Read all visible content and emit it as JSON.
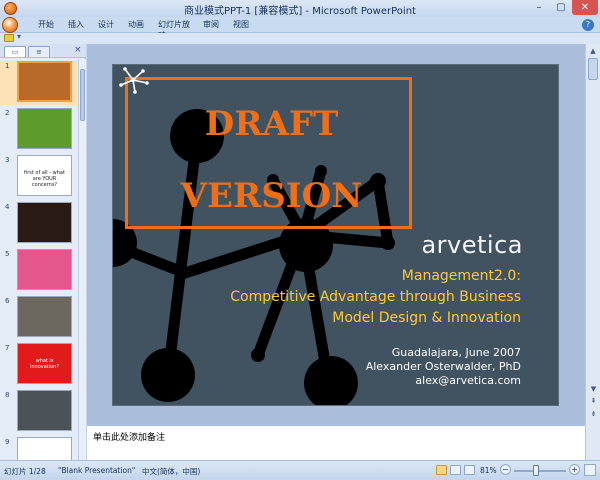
{
  "window": {
    "title": "商业模式PPT-1 [兼容模式] - Microsoft PowerPoint",
    "minimize_glyph": "–",
    "maximize_glyph": "▢",
    "close_glyph": "✕"
  },
  "ribbon": {
    "tabs": [
      "开始",
      "插入",
      "设计",
      "动画",
      "幻灯片放映",
      "审阅",
      "视图"
    ],
    "help_glyph": "?"
  },
  "qat": {
    "dropdown_glyph": "▾"
  },
  "panel": {
    "tab_slides_glyph": "▭",
    "tab_outline_glyph": "≡",
    "close_glyph": "×",
    "thumbnails": [
      {
        "number": "1",
        "bg": "#b86a2a",
        "text": "",
        "selected": true
      },
      {
        "number": "2",
        "bg": "#5d9b2a",
        "text": ""
      },
      {
        "number": "3",
        "bg": "#ffffff",
        "text": "first of all - what are YOUR concerns? ",
        "text_color": "#222222"
      },
      {
        "number": "4",
        "bg": "#2a1a14",
        "text": ""
      },
      {
        "number": "5",
        "bg": "#e4578c",
        "text": ""
      },
      {
        "number": "6",
        "bg": "#6c6860",
        "text": ""
      },
      {
        "number": "7",
        "bg": "#e31a1a",
        "text": "what is innovation?",
        "text_color": "#ffffff"
      },
      {
        "number": "8",
        "bg": "#4b5258",
        "text": ""
      },
      {
        "number": "9",
        "bg": "#ffffff",
        "text": "",
        "text_color": "#222222"
      }
    ]
  },
  "slide": {
    "draft_line1": "DRAFT",
    "draft_line2": "VERSION",
    "brand": "arvetica",
    "title_line1": "Management2.0:",
    "title_line2": "Competitive Advantage through Business",
    "title_line3": "Model Design & Innovation",
    "info_line1": "Guadalajara, June 2007",
    "info_line2": "Alexander Osterwalder, PhD",
    "info_line3": "alex@arvetica.com",
    "colors": {
      "background": "#415361",
      "draft": "#f06e17",
      "title": "#ffc936",
      "network": "#000000"
    }
  },
  "notes": {
    "placeholder": "单击此处添加备注"
  },
  "scroll": {
    "up_glyph": "▲",
    "down_glyph": "▼",
    "prev_glyph": "⇞",
    "next_glyph": "⇟"
  },
  "status": {
    "slide": "幻灯片 1/28",
    "theme": "\"Blank Presentation\"",
    "language": "中文(简体，中国)",
    "zoom": "81%",
    "zoom_out_glyph": "−",
    "zoom_in_glyph": "+"
  }
}
